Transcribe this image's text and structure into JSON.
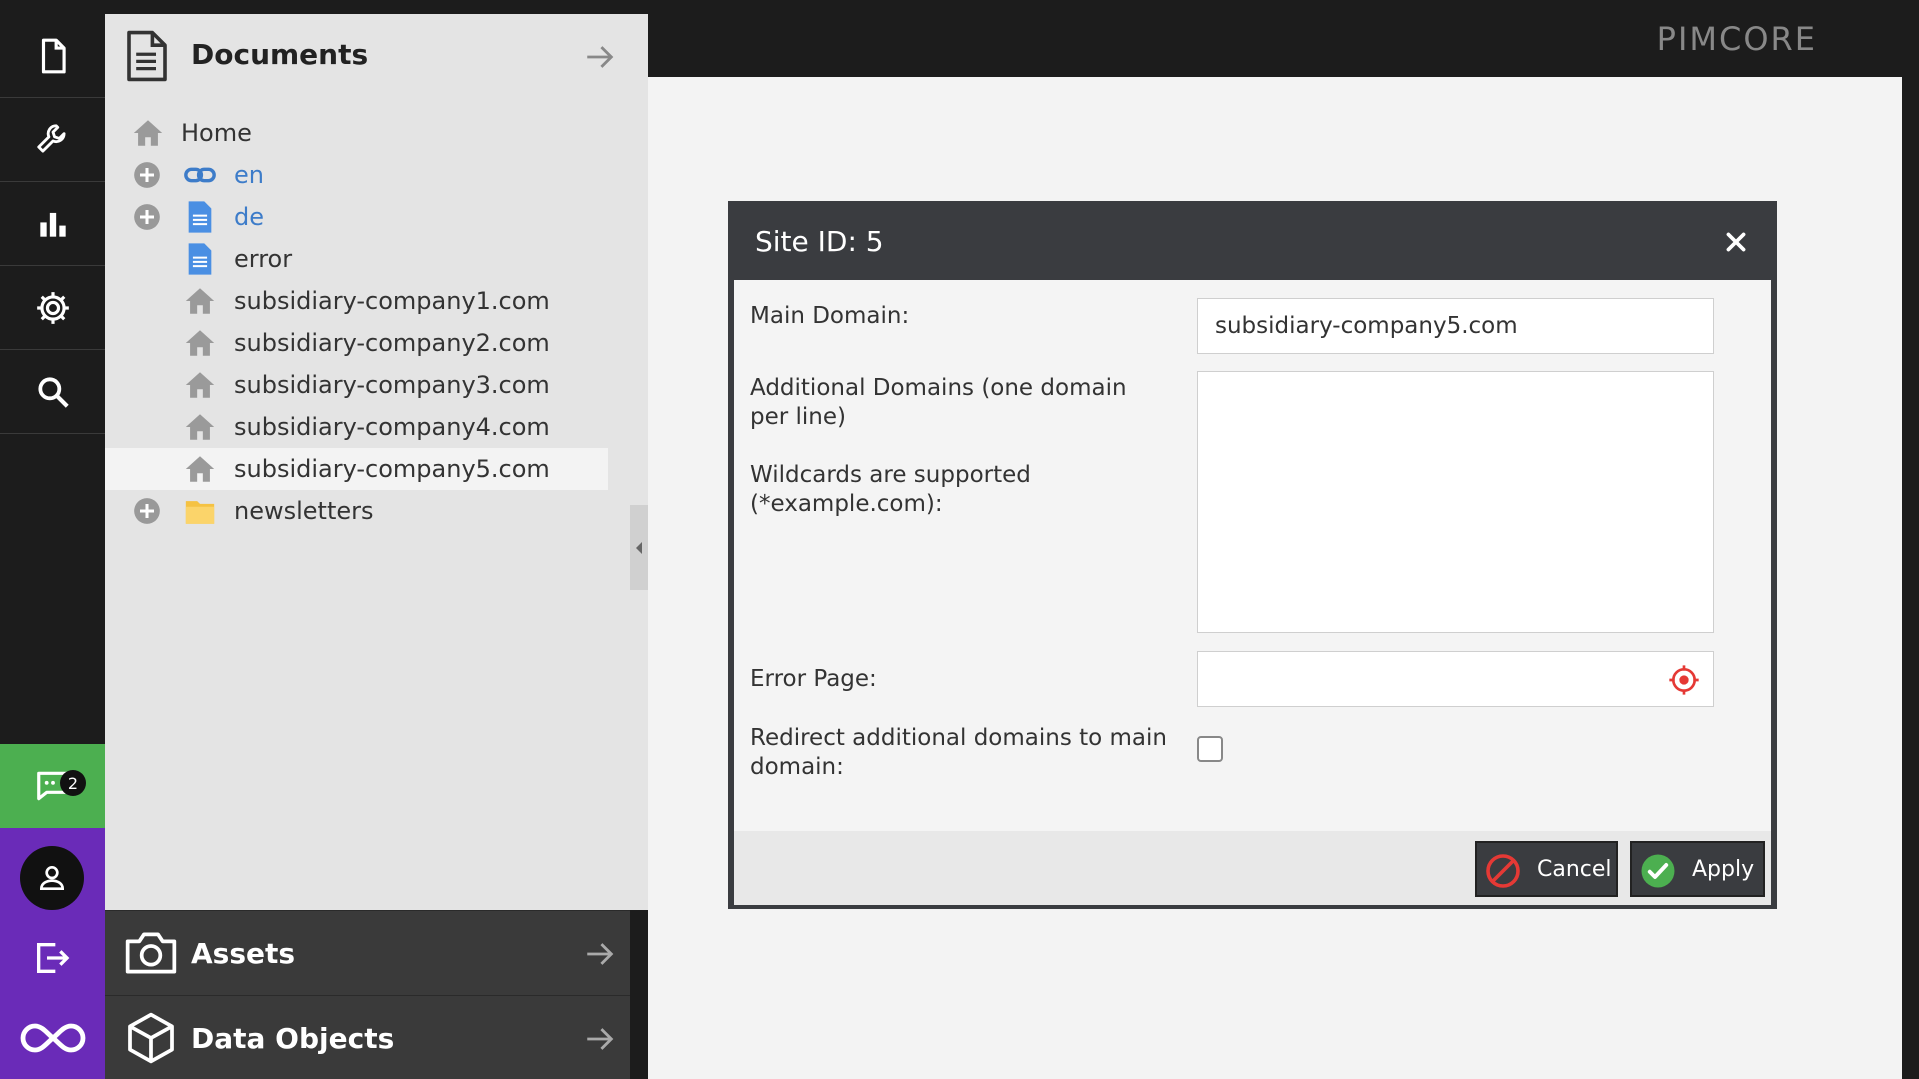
{
  "brand": "PIMCORE",
  "rail": {
    "items": [
      "documents-icon",
      "tools-icon",
      "reports-icon",
      "settings-icon",
      "search-icon"
    ],
    "notifications_count": "2"
  },
  "documents": {
    "title": "Documents",
    "tree": [
      {
        "label": "Home",
        "icon": "home-icon"
      },
      {
        "label": "en",
        "icon": "link-icon"
      },
      {
        "label": "de",
        "icon": "page-icon"
      },
      {
        "label": "error",
        "icon": "page-icon"
      },
      {
        "label": "subsidiary-company1.com",
        "icon": "home-icon"
      },
      {
        "label": "subsidiary-company2.com",
        "icon": "home-icon"
      },
      {
        "label": "subsidiary-company3.com",
        "icon": "home-icon"
      },
      {
        "label": "subsidiary-company4.com",
        "icon": "home-icon"
      },
      {
        "label": "subsidiary-company5.com",
        "icon": "home-icon",
        "selected": true
      },
      {
        "label": "newsletters",
        "icon": "folder-icon"
      }
    ]
  },
  "assets": {
    "title": "Assets"
  },
  "data_objects": {
    "title": "Data Objects"
  },
  "dialog": {
    "title": "Site ID: 5",
    "main_domain_label": "Main Domain:",
    "main_domain_value": "subsidiary-company5.com",
    "additional_domains_label": "Additional Domains (one domain per line)",
    "wildcards_label": "Wildcards are supported (*example.com):",
    "additional_domains_value": "",
    "error_page_label": "Error Page:",
    "error_page_value": "",
    "redirect_label": "Redirect additional domains to main domain:",
    "redirect_checked": false,
    "cancel_label": "Cancel",
    "apply_label": "Apply"
  },
  "colors": {
    "accent_green": "#4caf50",
    "accent_purple": "#6a2bb8",
    "link_blue": "#3d7cc9",
    "cancel_red": "#e53935"
  }
}
